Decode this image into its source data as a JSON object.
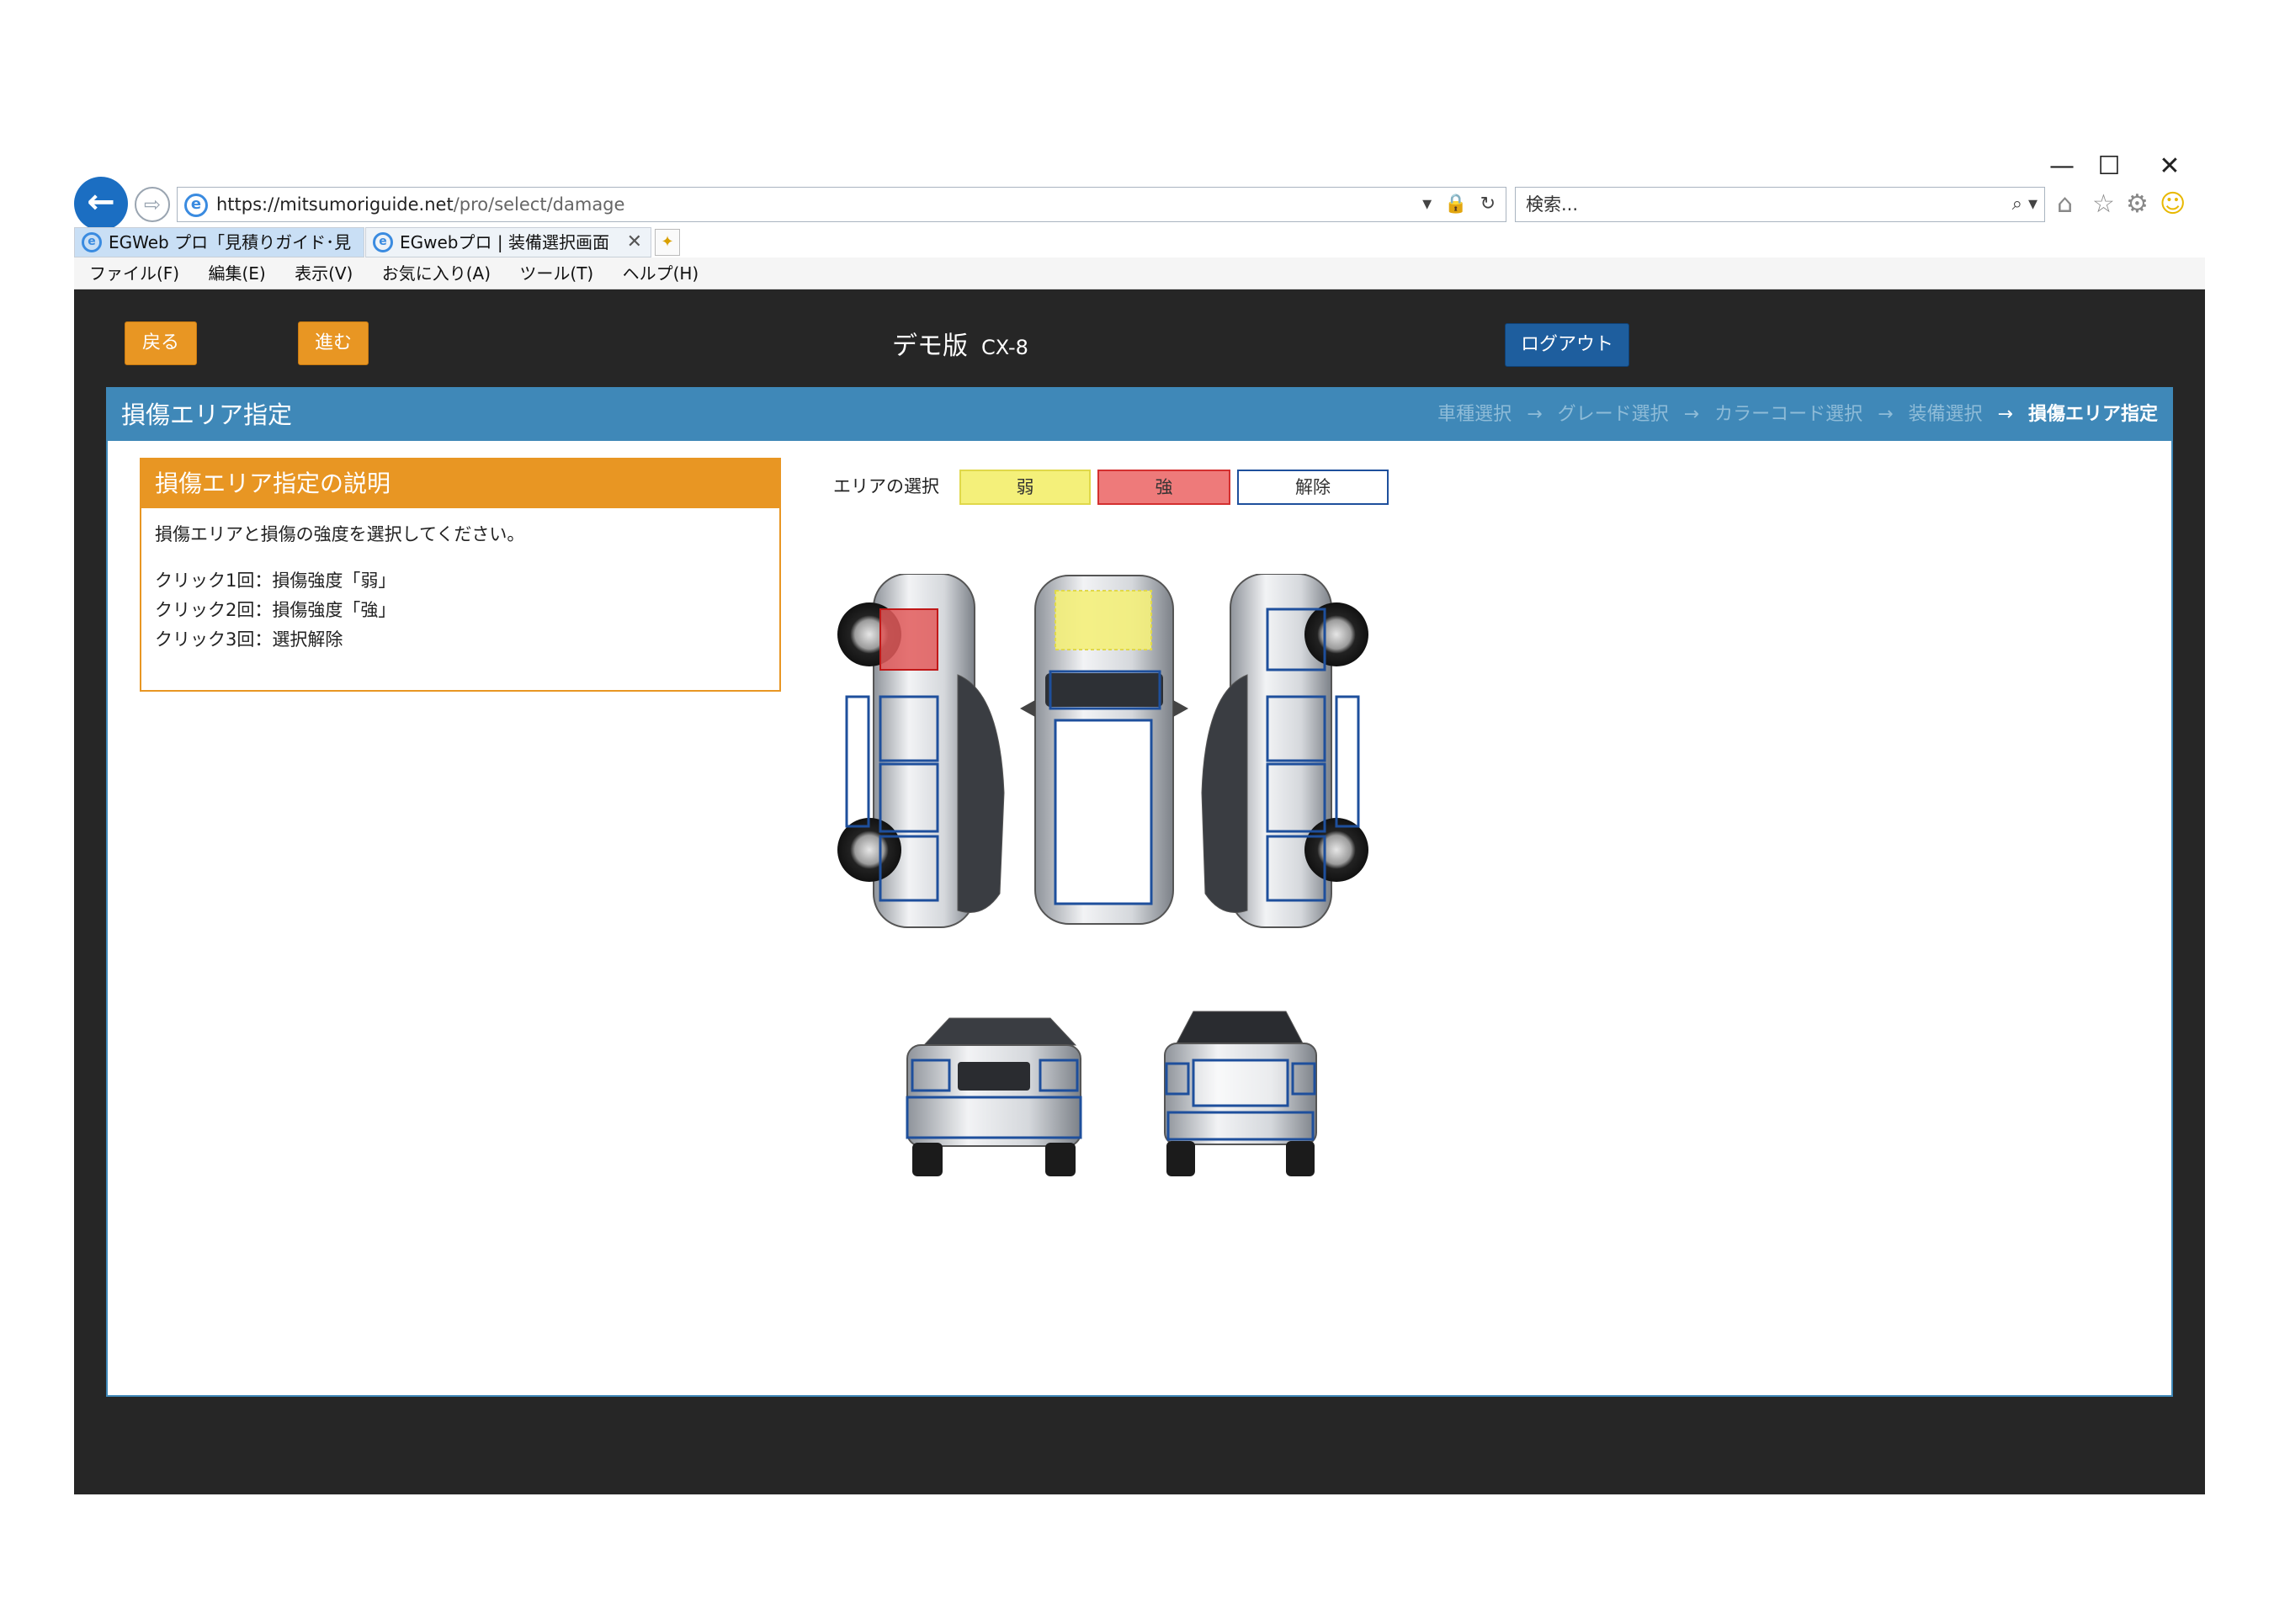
{
  "window": {
    "minimize": "—",
    "maximize": "☐",
    "close": "✕"
  },
  "browser": {
    "url_host": "https://mitsumoriguide.net",
    "url_path": "/pro/select/damage",
    "address_tools": "▾ 🔒 ↻",
    "search_placeholder": "検索...",
    "search_tools": "⌕ ▾",
    "tabs": [
      {
        "label": "EGWeb プロ「見積りガイド･見積り..."
      },
      {
        "label": "EGwebプロ | 装備選択画面"
      }
    ],
    "tab_close": "✕",
    "menu": [
      "ファイル(F)",
      "編集(E)",
      "表示(V)",
      "お気に入り(A)",
      "ツール(T)",
      "ヘルプ(H)"
    ],
    "icons": [
      "home-icon",
      "star-icon",
      "gear-icon",
      "smiley-icon"
    ]
  },
  "header": {
    "back_label": "戻る",
    "next_label": "進む",
    "title": "デモ版",
    "model": "CX-8",
    "logout_label": "ログアウト"
  },
  "panel": {
    "title": "損傷エリア指定",
    "breadcrumb": [
      "車種選択",
      "グレード選択",
      "カラーコード選択",
      "装備選択",
      "損傷エリア指定"
    ],
    "arrow": "→"
  },
  "help": {
    "title": "損傷エリア指定の説明",
    "intro": "損傷エリアと損傷の強度を選択してください。",
    "steps": [
      "クリック1回：損傷強度「弱」",
      "クリック2回：損傷強度「強」",
      "クリック3回：選択解除"
    ]
  },
  "area_select": {
    "label": "エリアの選択",
    "weak": "弱",
    "strong": "強",
    "clear": "解除"
  },
  "colors": {
    "weak": "#f4f07a",
    "strong": "#ee7a7a",
    "clear_border": "#1e4f9c",
    "accent": "#e89623",
    "panel": "#3f88b8"
  }
}
